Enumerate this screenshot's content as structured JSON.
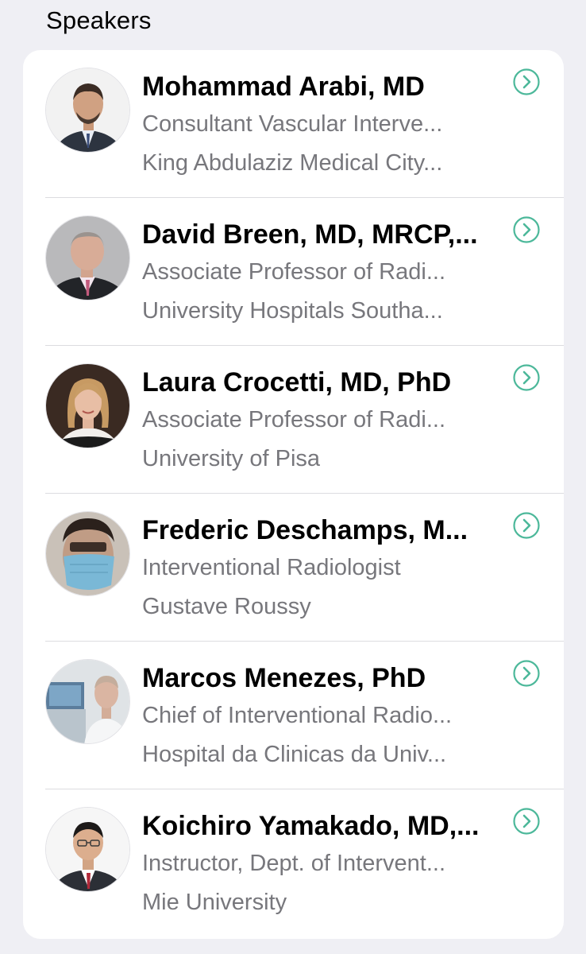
{
  "section": {
    "title": "Speakers"
  },
  "colors": {
    "accent": "#4cb89a",
    "background": "#efeff4",
    "card": "#ffffff",
    "secondary_text": "#77777c"
  },
  "speakers": [
    {
      "name": "Mohammad Arabi, MD",
      "title": "Consultant Vascular Interve...",
      "organization": "King Abdulaziz Medical City...",
      "icon": "chevron-right-circle-icon"
    },
    {
      "name": "David Breen, MD, MRCP,...",
      "title": "Associate Professor of Radi...",
      "organization": "University Hospitals Southa...",
      "icon": "chevron-right-circle-icon"
    },
    {
      "name": "Laura Crocetti, MD, PhD",
      "title": "Associate Professor of Radi...",
      "organization": "University of Pisa",
      "icon": "chevron-right-circle-icon"
    },
    {
      "name": "Frederic Deschamps, M...",
      "title": "Interventional Radiologist",
      "organization": "Gustave Roussy",
      "icon": "chevron-right-circle-icon"
    },
    {
      "name": "Marcos Menezes, PhD",
      "title": "Chief of Interventional Radio...",
      "organization": "Hospital da Clinicas da Univ...",
      "icon": "chevron-right-circle-icon"
    },
    {
      "name": "Koichiro Yamakado, MD,...",
      "title": "Instructor, Dept. of Intervent...",
      "organization": "Mie University",
      "icon": "chevron-right-circle-icon"
    }
  ]
}
